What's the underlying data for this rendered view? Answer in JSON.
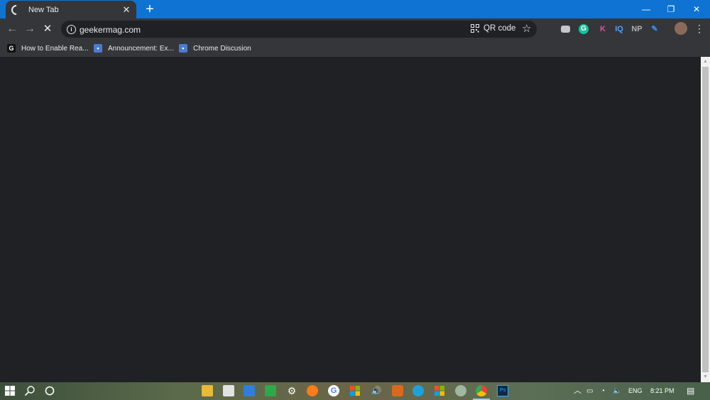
{
  "tab": {
    "title": "New Tab"
  },
  "window_controls": {
    "minimize": "—",
    "restore": "❐",
    "close": "✕"
  },
  "nav": {
    "back": "←",
    "forward": "→",
    "stop": "✕"
  },
  "omnibox": {
    "url": "geekermag.com"
  },
  "qr": {
    "label": "QR code"
  },
  "extensions": [
    {
      "name": "camera-icon",
      "text": "",
      "color": "#c7c7c7"
    },
    {
      "name": "grammarly-icon",
      "text": "G",
      "color": "#15c39a"
    },
    {
      "name": "k-extension-icon",
      "text": "K",
      "color": "#e04fa0"
    },
    {
      "name": "iq-extension-icon",
      "text": "IQ",
      "color": "#4aa3ff"
    },
    {
      "name": "np-extension-icon",
      "text": "NP",
      "color": "#b0b0b0"
    },
    {
      "name": "pen-extension-icon",
      "text": "",
      "color": "#3b8eea"
    }
  ],
  "bookmarks": [
    {
      "label": "How to Enable Rea..."
    },
    {
      "label": "Announcement: Ex..."
    },
    {
      "label": "Chrome Discusion"
    }
  ],
  "taskbar": {
    "language": "ENG",
    "time": "8:21 PM"
  },
  "colors": {
    "titlebar": "#0f73d3",
    "toolbar": "#35363a",
    "page": "#202124"
  }
}
